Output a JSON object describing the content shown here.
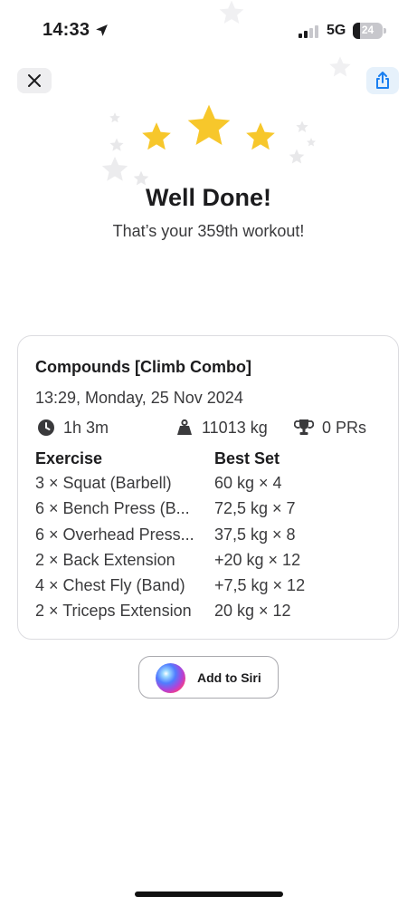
{
  "status_bar": {
    "time": "14:33",
    "network": "5G",
    "battery": "24",
    "battery_level": 0.24
  },
  "header": {
    "close_icon": "xmark-icon",
    "share_icon": "share-icon"
  },
  "hero": {
    "title": "Well Done!",
    "subtitle": "That’s your 359th workout!",
    "star_color": "#f7c72b"
  },
  "workout": {
    "title": "Compounds [Climb Combo]",
    "date": "13:29, Monday, 25 Nov 2024",
    "duration": "1h 3m",
    "volume": "11013 kg",
    "prs": "0 PRs",
    "exercise_header": "Exercise",
    "best_set_header": "Best Set",
    "exercises": [
      {
        "name": "3 × Squat (Barbell)",
        "best_set": "60 kg × 4"
      },
      {
        "name": "6 × Bench Press (B...",
        "best_set": "72,5 kg × 7"
      },
      {
        "name": "6 × Overhead Press...",
        "best_set": "37,5 kg × 8"
      },
      {
        "name": "2 × Back Extension",
        "best_set": "+20 kg × 12"
      },
      {
        "name": "4 × Chest Fly (Band)",
        "best_set": "+7,5 kg × 12"
      },
      {
        "name": "2 × Triceps Extension",
        "best_set": "20 kg × 12"
      }
    ]
  },
  "siri": {
    "label": "Add to Siri"
  }
}
